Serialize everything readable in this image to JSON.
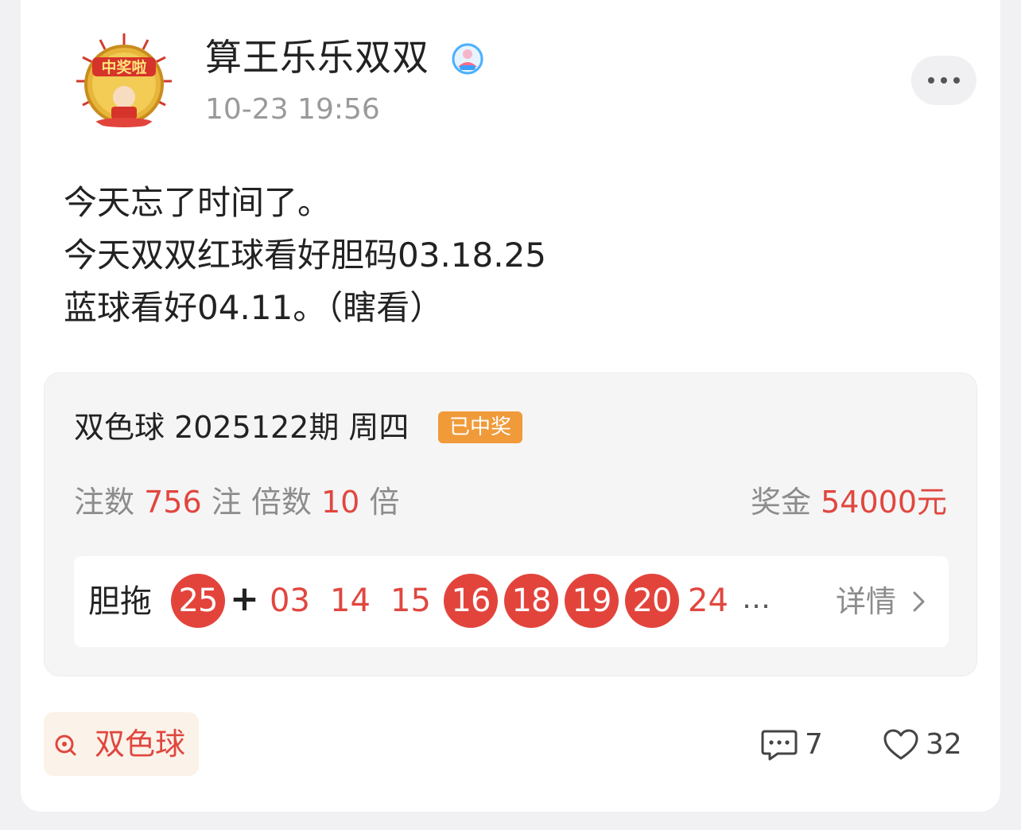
{
  "post": {
    "author_name": "算王乐乐双双",
    "avatar_text": "中奖啦",
    "timestamp": "10-23 19:56",
    "text_lines": [
      "今天忘了时间了。",
      "今天双双红球看好胆码03.18.25",
      "蓝球看好04.11。（瞎看）"
    ]
  },
  "ticket": {
    "title": "双色球 2025122期 周四",
    "status_tag": "已中奖",
    "bets_label": "注数",
    "bets_value": "756",
    "bets_unit": "注",
    "multiple_label": "倍数",
    "multiple_value": "10",
    "multiple_unit": "倍",
    "prize_label": "奖金",
    "prize_value": "54000元",
    "numbers_label": "胆拖",
    "banker": "25",
    "plus": "+",
    "drag_numbers": [
      "03",
      "14",
      "15",
      "16",
      "18",
      "19",
      "20",
      "24"
    ],
    "ellipsis": "…",
    "detail_label": "详情"
  },
  "footer": {
    "topic_label": "双色球",
    "comment_count": "7",
    "like_count": "32"
  },
  "colors": {
    "accent_red": "#e0473f",
    "won_tag": "#f09a3a",
    "topic_bg": "#fbf3ea"
  }
}
